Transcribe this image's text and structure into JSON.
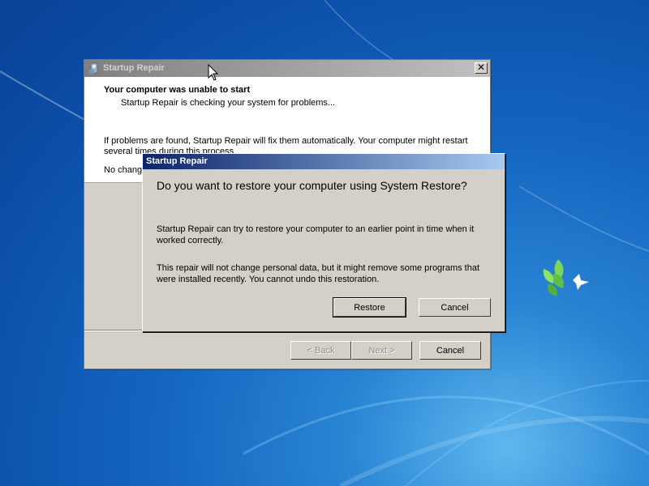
{
  "main_window": {
    "title": "Startup Repair",
    "close_glyph": "✕",
    "header_title": "Your computer was unable to start",
    "header_subtitle": "Startup Repair is checking your system for problems...",
    "body_text": "If problems are found, Startup Repair will fix them automatically. Your computer might restart several times during this process.",
    "body_text_partial": "No changes",
    "buttons": {
      "back": "< Back",
      "next": "Next >",
      "cancel": "Cancel"
    }
  },
  "dialog": {
    "title": "Startup Repair",
    "question": "Do you want to restore your computer using System Restore?",
    "text1": "Startup Repair can try to restore your computer to an earlier point in time when it worked correctly.",
    "text2": "This repair will not change personal data, but it might remove some programs that were installed recently. You cannot undo this restoration.",
    "buttons": {
      "restore": "Restore",
      "cancel": "Cancel"
    }
  },
  "icons": {
    "app": "startup-repair-icon",
    "close": "close-icon",
    "cursor": "mouse-pointer-icon",
    "wallpaper_logo": "windows-dove-logo-icon"
  },
  "colors": {
    "desktop": "#1466c0",
    "dialog_face": "#d4d0c8",
    "active_title_start": "#0a246a",
    "active_title_end": "#a6caf0",
    "inactive_title_start": "#808080",
    "inactive_title_end": "#c0c0c0"
  }
}
